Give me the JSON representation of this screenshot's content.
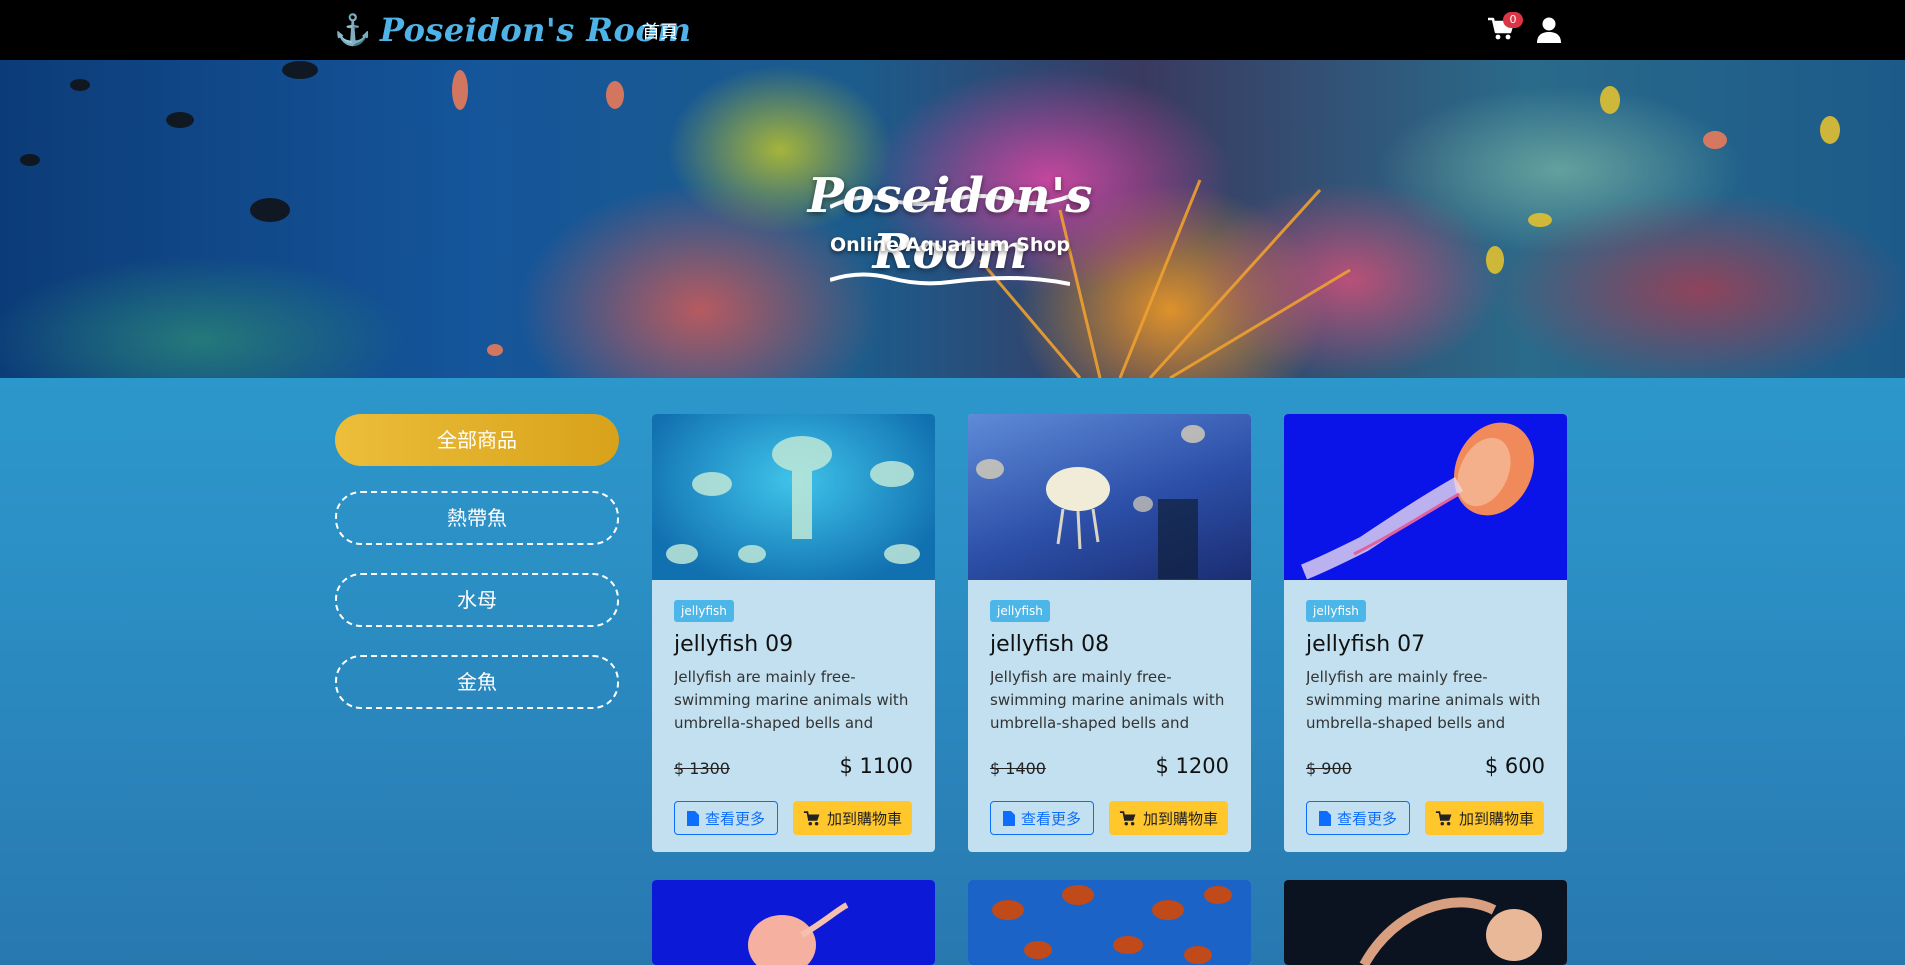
{
  "navbar": {
    "brand": "Poseidon's Room",
    "home": "首頁",
    "cart_count": "0"
  },
  "hero": {
    "title": "Poseidon's Room",
    "subtitle": "Online Aquarium  Shop"
  },
  "sidebar": {
    "items": [
      {
        "label": "全部商品",
        "active": true
      },
      {
        "label": "熱帶魚",
        "active": false
      },
      {
        "label": "水母",
        "active": false
      },
      {
        "label": "金魚",
        "active": false
      }
    ]
  },
  "products": [
    {
      "tag": "jellyfish",
      "title": "jellyfish 09",
      "description": "Jellyfish are mainly free-swimming marine animals with umbrella-shaped bells and trailing tentacle...",
      "original_price": "$ 1300",
      "price": "$ 1100",
      "more_label": "查看更多",
      "cart_label": "加到購物車"
    },
    {
      "tag": "jellyfish",
      "title": "jellyfish 08",
      "description": "Jellyfish are mainly free-swimming marine animals with umbrella-shaped bells and trailing tentacle...",
      "original_price": "$ 1400",
      "price": "$ 1200",
      "more_label": "查看更多",
      "cart_label": "加到購物車"
    },
    {
      "tag": "jellyfish",
      "title": "jellyfish 07",
      "description": "Jellyfish are mainly free-swimming marine animals with umbrella-shaped bells and trailing tentacle...",
      "original_price": "$ 900",
      "price": "$ 600",
      "more_label": "查看更多",
      "cart_label": "加到購物車"
    }
  ],
  "icons": {
    "brand": "anchor-icon",
    "cart": "shopping-cart-icon",
    "user": "user-icon",
    "more": "file-icon",
    "add_to_cart": "shopping-cart-icon"
  },
  "colors": {
    "navbar": "#000000",
    "brand": "#4fb3e8",
    "accent": "#ffc72c",
    "active_category": "#e0ac24",
    "link": "#0d6efd",
    "badge": "#dc3545",
    "card": "#c2e0ef"
  }
}
